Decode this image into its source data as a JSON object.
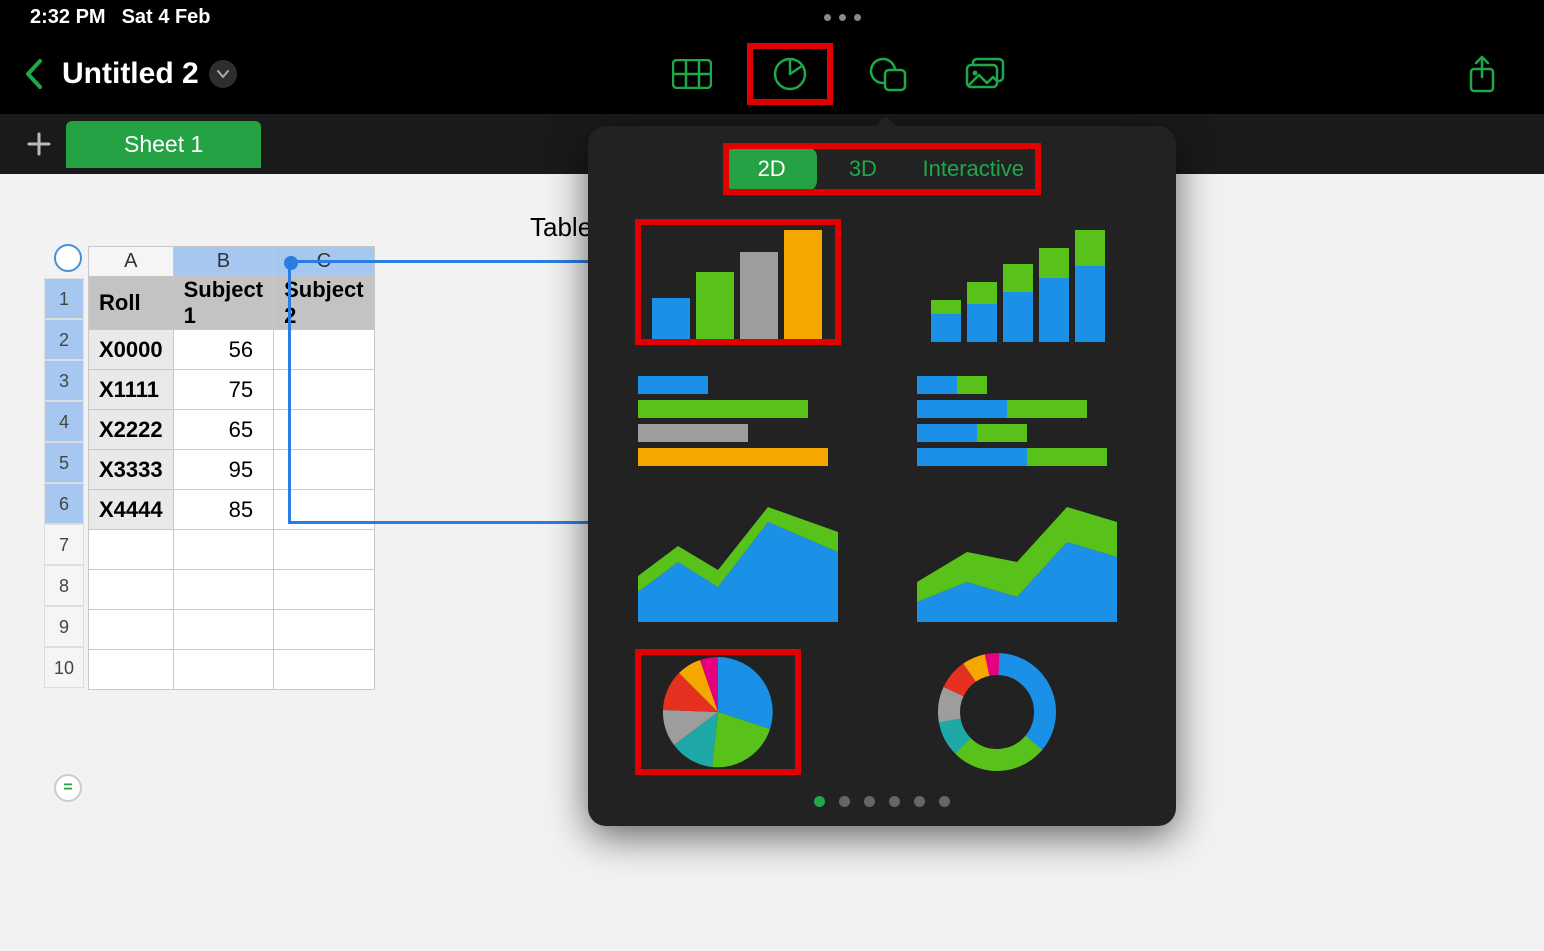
{
  "statusbar": {
    "time": "2:32 PM",
    "date": "Sat 4 Feb"
  },
  "document": {
    "title": "Untitled 2"
  },
  "sheets": {
    "active": "Sheet 1"
  },
  "table": {
    "title": "Table",
    "columns": [
      "A",
      "B",
      "C"
    ],
    "headers": {
      "roll": "Roll",
      "sub1": "Subject 1",
      "sub2": "Subject 2"
    },
    "rows": [
      {
        "roll": "X0000",
        "sub1": 56
      },
      {
        "roll": "X1111",
        "sub1": 75
      },
      {
        "roll": "X2222",
        "sub1": 65
      },
      {
        "roll": "X3333",
        "sub1": 95
      },
      {
        "roll": "X4444",
        "sub1": 85
      }
    ],
    "row_numbers": [
      "1",
      "2",
      "3",
      "4",
      "5",
      "6",
      "7",
      "8",
      "9",
      "10"
    ]
  },
  "chart_popover": {
    "segments": {
      "s1": "2D",
      "s2": "3D",
      "s3": "Interactive"
    },
    "tiles": [
      "bar-chart",
      "stacked-bar-chart",
      "horizontal-bar-chart",
      "horizontal-stacked-bar-chart",
      "area-chart",
      "stacked-area-chart",
      "pie-chart",
      "donut-chart"
    ],
    "pager_count": 6,
    "pager_active": 0
  },
  "formula_button": "="
}
